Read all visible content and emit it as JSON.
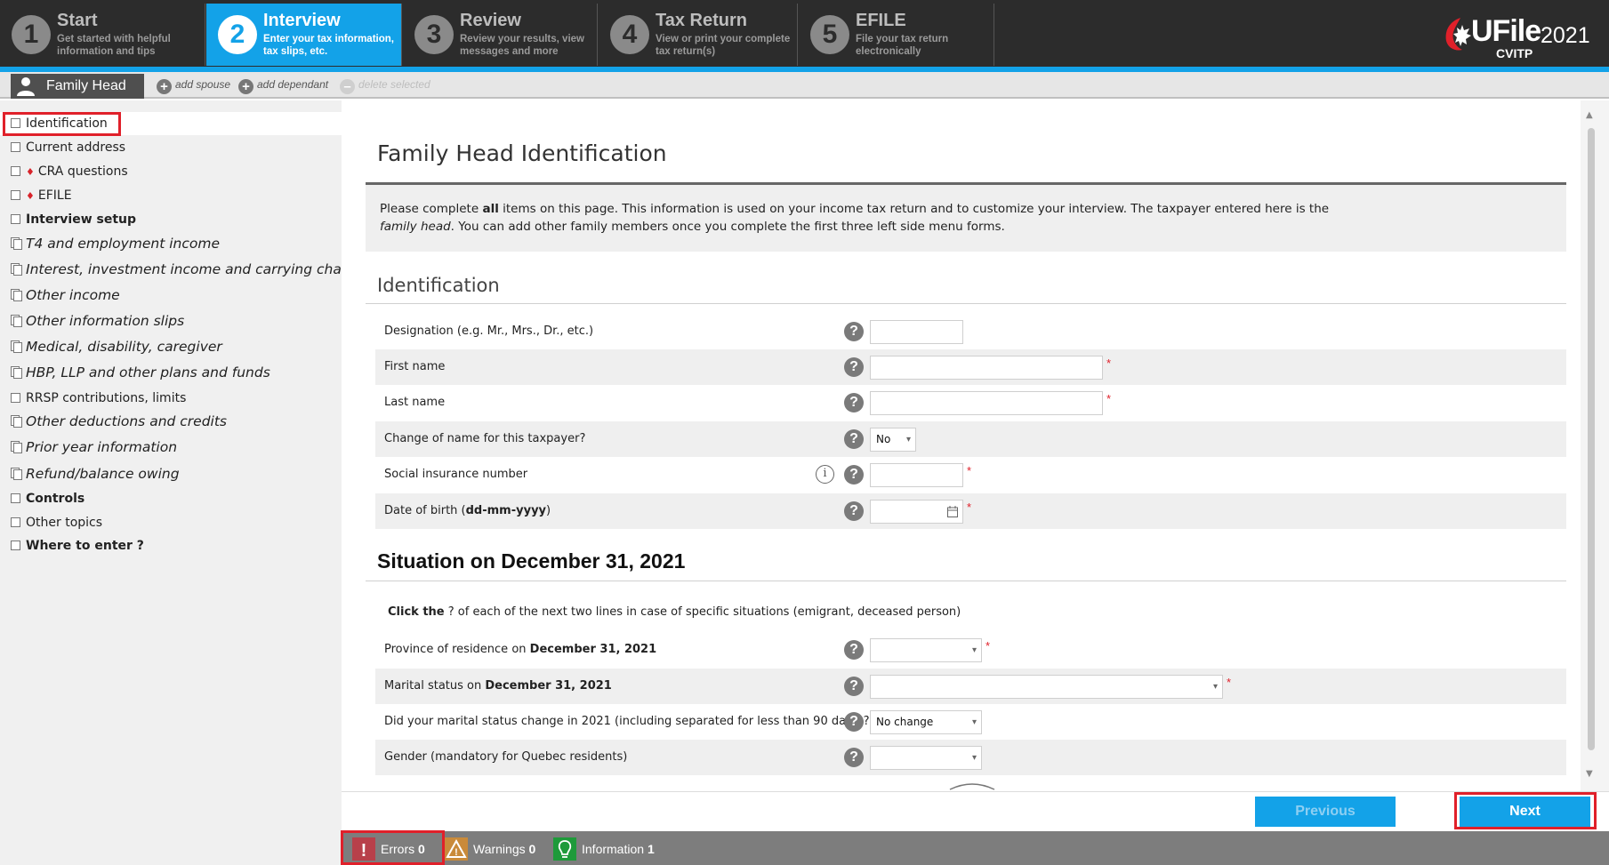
{
  "steps": [
    {
      "num": "1",
      "title": "Start",
      "desc": "Get started with helpful information and tips"
    },
    {
      "num": "2",
      "title": "Interview",
      "desc": "Enter your tax information, tax slips, etc."
    },
    {
      "num": "3",
      "title": "Review",
      "desc": "Review your results, view messages and more"
    },
    {
      "num": "4",
      "title": "Tax Return",
      "desc": "View or print your complete tax return(s)"
    },
    {
      "num": "5",
      "title": "EFILE",
      "desc": "File your tax return electronically"
    }
  ],
  "logo": {
    "text": "UFile",
    "year": "2021",
    "sub": "CVITP"
  },
  "familybar": {
    "tab_label": "Family Head",
    "add_spouse": "add spouse",
    "add_dependant": "add dependant",
    "delete_selected": "delete selected"
  },
  "sidebar": {
    "items": [
      {
        "label": "Identification"
      },
      {
        "label": "Current address"
      },
      {
        "label": "CRA questions"
      },
      {
        "label": "EFILE"
      },
      {
        "label": "Interview setup"
      },
      {
        "label": "T4 and employment income"
      },
      {
        "label": "Interest, investment income and carrying charges"
      },
      {
        "label": "Other income"
      },
      {
        "label": "Other information slips"
      },
      {
        "label": "Medical, disability, caregiver"
      },
      {
        "label": "HBP, LLP and other plans and funds"
      },
      {
        "label": "RRSP contributions, limits"
      },
      {
        "label": "Other deductions and credits"
      },
      {
        "label": "Prior year information"
      },
      {
        "label": "Refund/balance owing"
      },
      {
        "label": "Controls"
      },
      {
        "label": "Other topics"
      },
      {
        "label": "Where to enter ?"
      }
    ]
  },
  "main": {
    "title": "Family Head Identification",
    "intro_1": "Please complete ",
    "intro_bold": "all",
    "intro_2": " items on this page. This information is used on your income tax return and to customize your interview. The taxpayer entered here is the ",
    "intro_italic": "family head",
    "intro_3": ". You can add other family members once you complete the first three left side menu forms.",
    "section_identification": "Identification",
    "rows": [
      {
        "label": "Designation (e.g. Mr., Mrs., Dr., etc.)",
        "value": ""
      },
      {
        "label": "First name",
        "value": ""
      },
      {
        "label": "Last name",
        "value": ""
      },
      {
        "label": "Change of name for this taxpayer?",
        "value": "No"
      },
      {
        "label": "Social insurance number",
        "value": ""
      },
      {
        "label": "Date of birth (",
        "label_bold": "dd-mm-yyyy",
        "label_end": ")",
        "value": ""
      }
    ],
    "section_situation": "Situation on December 31, 2021",
    "situation_note_bold": "Click the",
    "situation_note": " ? of each of the next two lines in case of specific situations (emigrant, deceased person)",
    "situation_rows": [
      {
        "label": "Province of residence on ",
        "label_bold": "December 31, 2021",
        "value": ""
      },
      {
        "label": "Marital status on ",
        "label_bold": "December 31, 2021",
        "value": ""
      },
      {
        "label": "Did your marital status change in 2021 (including separated for less than 90 days)?",
        "value": "No change"
      },
      {
        "label": "Gender (mandatory for Quebec residents)",
        "value": ""
      }
    ]
  },
  "buttons": {
    "previous": "Previous",
    "next": "Next"
  },
  "status": {
    "errors_label": "Errors",
    "errors_count": "0",
    "warnings_label": "Warnings",
    "warnings_count": "0",
    "info_label": "Information",
    "info_count": "1"
  },
  "colors": {
    "accent": "#13a2e8",
    "highlight": "#e0202a",
    "dark": "#2c2c2c"
  }
}
